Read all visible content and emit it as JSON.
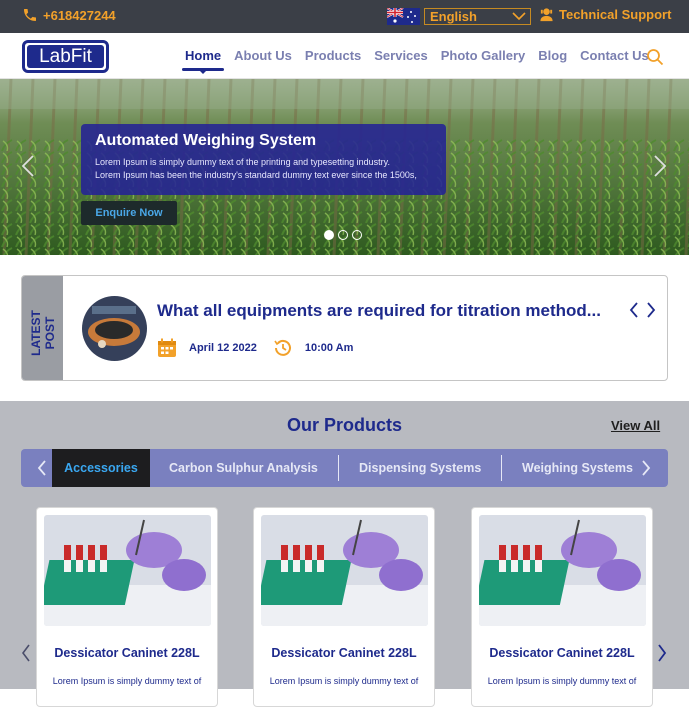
{
  "topbar": {
    "phone": "+618427244",
    "language": "English",
    "support": "Technical Support"
  },
  "navbar": {
    "logo": "LabFit",
    "menu": [
      {
        "label": "Home",
        "active": true
      },
      {
        "label": "About Us"
      },
      {
        "label": "Products"
      },
      {
        "label": "Services"
      },
      {
        "label": "Photo Gallery"
      },
      {
        "label": "Blog"
      },
      {
        "label": "Contact Us"
      }
    ]
  },
  "hero": {
    "title": "Automated Weighing System",
    "text_line1": "Lorem Ipsum is simply dummy text of the printing and typesetting industry.",
    "text_line2": "Lorem Ipsum has been the industry's standard dummy text ever since the 1500s,",
    "cta": "Enquire Now",
    "slides": 3,
    "active_slide": 1
  },
  "latest_post": {
    "tag": "LATEST POST",
    "title": "What all equipments are required for titration method...",
    "date": "April 12 2022",
    "time": "10:00 Am"
  },
  "products": {
    "heading": "Our Products",
    "view_all": "View All",
    "tabs": [
      "Accessories",
      "Carbon Sulphur Analysis",
      "Dispensing Systems",
      "Weighing Systems"
    ],
    "active_tab": 0,
    "cards": [
      {
        "title": "Dessicator Caninet 228L",
        "text": "Lorem Ipsum is simply dummy text of"
      },
      {
        "title": "Dessicator Caninet 228L",
        "text": "Lorem Ipsum is simply dummy text of"
      },
      {
        "title": "Dessicator Caninet 228L",
        "text": "Lorem Ipsum is simply dummy text of"
      }
    ]
  },
  "colors": {
    "brand_blue": "#1e2a8c",
    "accent_orange": "#f2a12a",
    "topbar_bg": "#3b3f47",
    "tabs_bg": "#7a80bf",
    "section_bg": "#b8bac0"
  },
  "icons": [
    "phone-icon",
    "australia-flag-icon",
    "chevron-down-icon",
    "support-agent-icon",
    "search-icon",
    "chevron-left-icon",
    "chevron-right-icon",
    "calendar-icon",
    "clock-icon"
  ]
}
